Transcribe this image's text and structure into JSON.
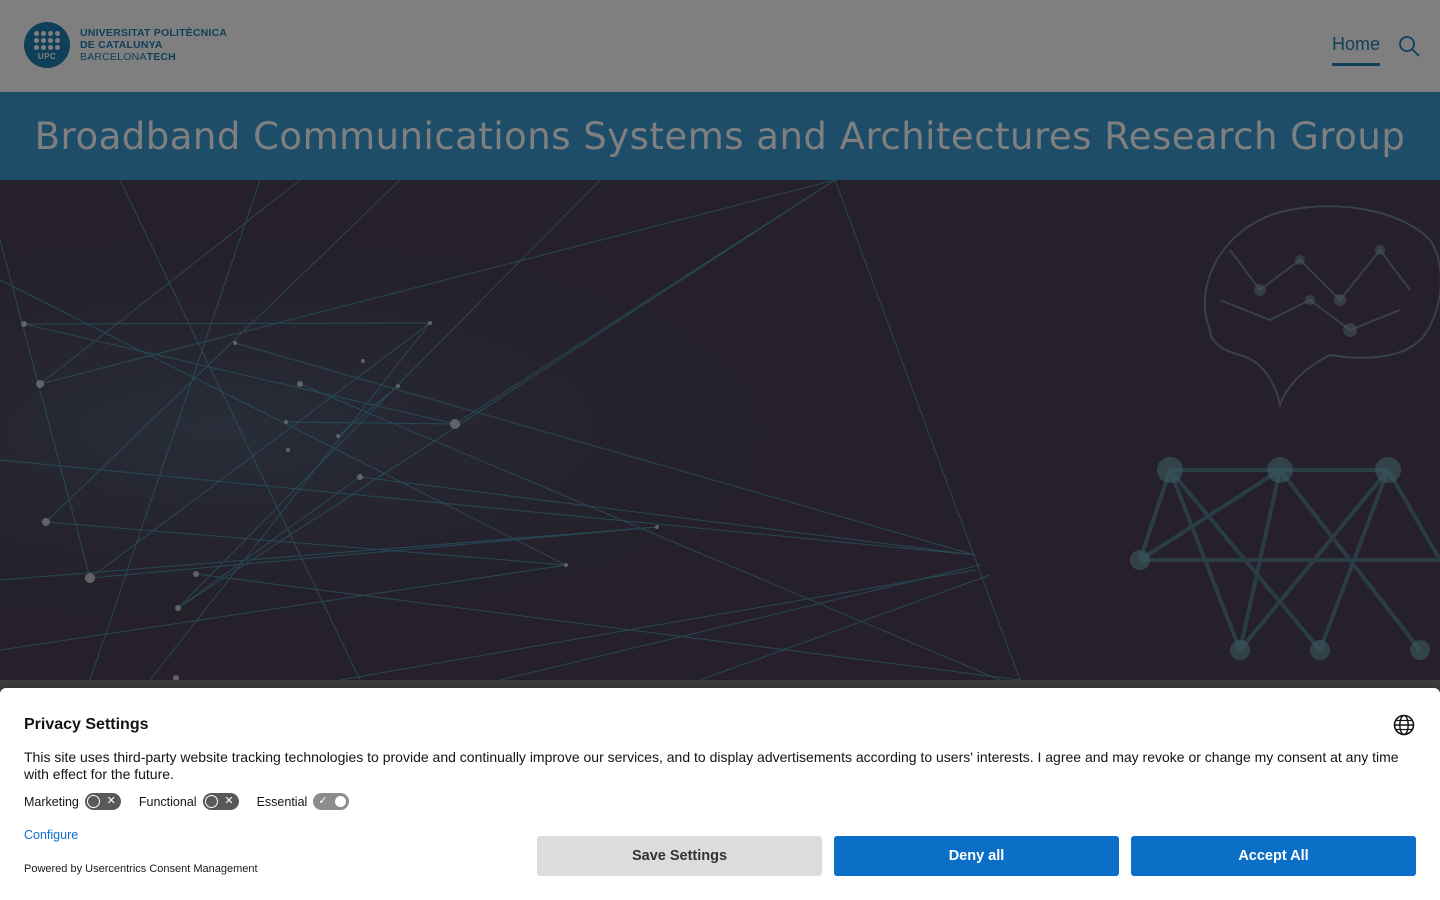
{
  "header": {
    "logo": {
      "badge_text": "UPC",
      "line1": "UNIVERSITAT POLITÈCNICA",
      "line2": "DE CATALUNYA",
      "line3_light": "BARCELONA",
      "line3_bold": "TECH"
    },
    "nav": {
      "home_label": "Home"
    },
    "search_icon": "search-icon"
  },
  "title_band": {
    "title": "Broadband Communications Systems and Architectures Research Group"
  },
  "consent": {
    "title": "Privacy Settings",
    "description": "This site uses third-party website tracking technologies to provide and continually improve our services, and to display advertisements according to users' interests. I agree and may revoke or change my consent at any time with effect for the future.",
    "toggles": [
      {
        "label": "Marketing",
        "enabled": false
      },
      {
        "label": "Functional",
        "enabled": false
      },
      {
        "label": "Essential",
        "enabled": true
      }
    ],
    "configure_label": "Configure",
    "powered_by": "Powered by Usercentrics Consent Management",
    "buttons": {
      "save": "Save Settings",
      "deny": "Deny all",
      "accept": "Accept All"
    },
    "language_icon": "globe-icon"
  },
  "colors": {
    "brand_blue": "#1f7fb3",
    "band_blue": "#3a9bd0",
    "button_blue": "#0b6fc7",
    "hero_bg": "#4a4156"
  }
}
